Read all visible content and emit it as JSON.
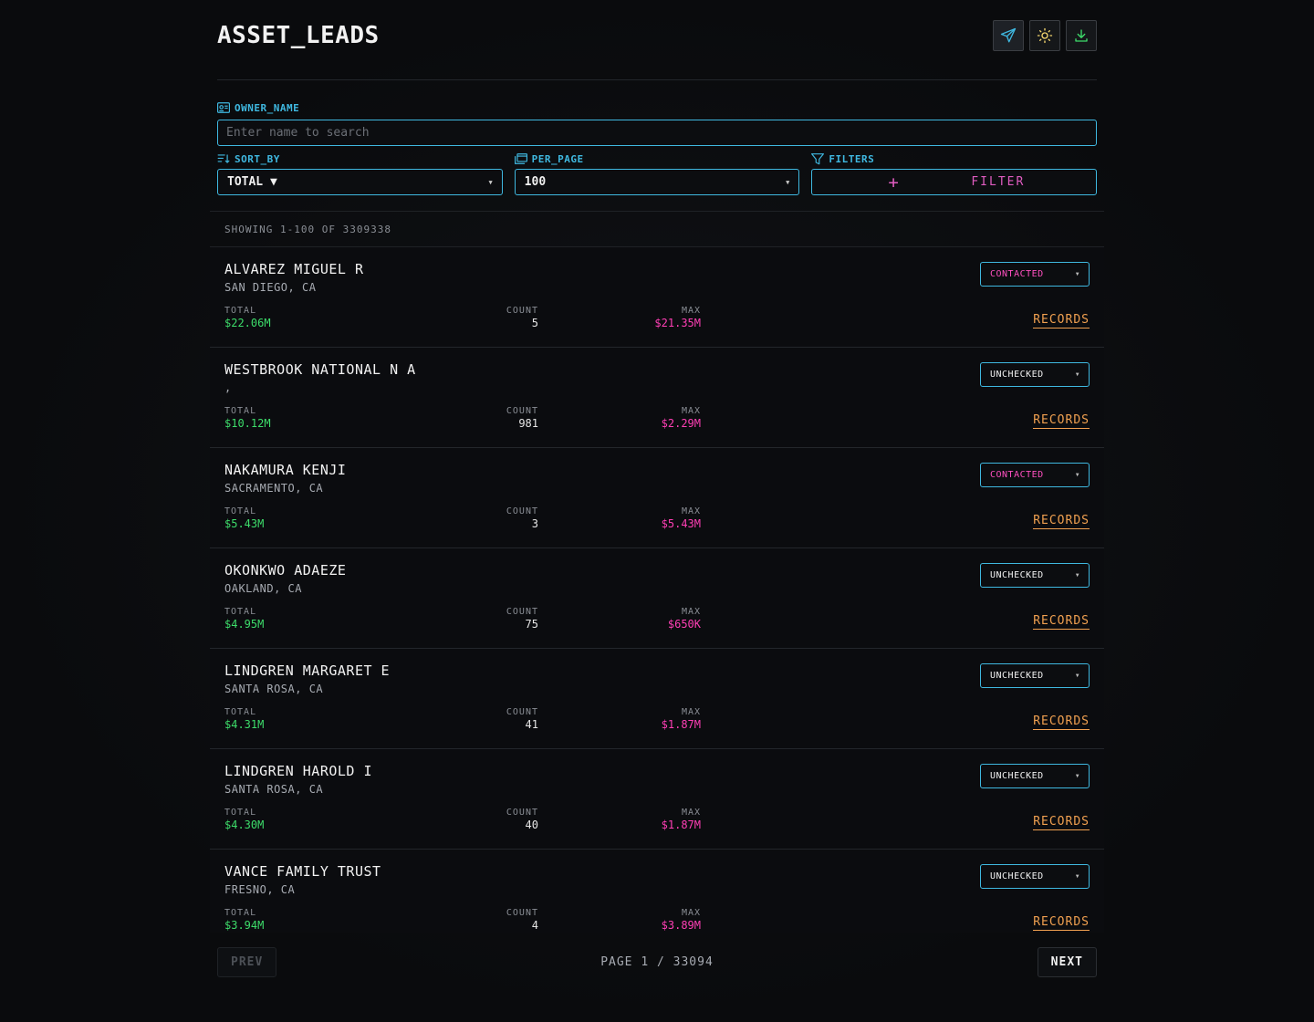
{
  "app": {
    "title": "ASSET_LEADS"
  },
  "header": {
    "icons": [
      "send-icon",
      "sun-icon",
      "download-icon"
    ]
  },
  "search": {
    "label": "OWNER_NAME",
    "placeholder": "Enter name to search",
    "value": ""
  },
  "sort": {
    "label": "SORT_BY",
    "value": "TOTAL ▼"
  },
  "per_page": {
    "label": "PER_PAGE",
    "value": "100"
  },
  "filters": {
    "label": "FILTERS",
    "button_label": "FILTER"
  },
  "list": {
    "showing": "SHOWING 1-100 OF 3309338",
    "stat_labels": {
      "total": "TOTAL",
      "count": "COUNT",
      "max": "MAX"
    },
    "records_label": "RECORDS",
    "rows": [
      {
        "name": "ALVAREZ MIGUEL R",
        "location": "SAN DIEGO, CA",
        "total": "$22.06M",
        "count": "5",
        "max": "$21.35M",
        "status": "CONTACTED"
      },
      {
        "name": "WESTBROOK NATIONAL N A",
        "location": ",",
        "total": "$10.12M",
        "count": "981",
        "max": "$2.29M",
        "status": "UNCHECKED"
      },
      {
        "name": "NAKAMURA KENJI",
        "location": "SACRAMENTO, CA",
        "total": "$5.43M",
        "count": "3",
        "max": "$5.43M",
        "status": "CONTACTED"
      },
      {
        "name": "OKONKWO ADAEZE",
        "location": "OAKLAND, CA",
        "total": "$4.95M",
        "count": "75",
        "max": "$650K",
        "status": "UNCHECKED"
      },
      {
        "name": "LINDGREN MARGARET E",
        "location": "SANTA ROSA, CA",
        "total": "$4.31M",
        "count": "41",
        "max": "$1.87M",
        "status": "UNCHECKED"
      },
      {
        "name": "LINDGREN HAROLD I",
        "location": "SANTA ROSA, CA",
        "total": "$4.30M",
        "count": "40",
        "max": "$1.87M",
        "status": "UNCHECKED"
      },
      {
        "name": "VANCE FAMILY TRUST",
        "location": "FRESNO, CA",
        "total": "$3.94M",
        "count": "4",
        "max": "$3.89M",
        "status": "UNCHECKED"
      }
    ]
  },
  "pager": {
    "prev_label": "PREV",
    "next_label": "NEXT",
    "page_info": "PAGE 1 / 33094"
  },
  "colors": {
    "accent": "#3fb8e0",
    "magenta": "#ff3fb5",
    "green": "#3ddc6a",
    "orange": "#f0a050"
  }
}
